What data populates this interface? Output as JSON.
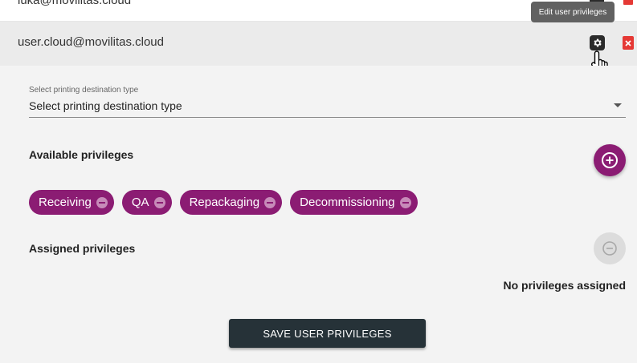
{
  "users": [
    {
      "email": "luka@movilitas.cloud"
    },
    {
      "email": "user.cloud@movilitas.cloud"
    }
  ],
  "tooltip": {
    "text": "Edit user privileges"
  },
  "printing": {
    "label": "Select printing destination type",
    "value": "Select printing destination type"
  },
  "available": {
    "heading": "Available privileges",
    "chips": [
      "Receiving",
      "QA",
      "Repackaging",
      "Decommissioning"
    ]
  },
  "assigned": {
    "heading": "Assigned privileges",
    "empty_text": "No privileges assigned"
  },
  "actions": {
    "save_label": "SAVE USER PRIVILEGES"
  },
  "colors": {
    "accent": "#8b1c73",
    "delete": "#e53935",
    "save_button": "#263238"
  },
  "icons": {
    "settings": "gear-icon",
    "delete": "trash-icon",
    "add": "plus-circle-icon",
    "remove": "minus-circle-icon",
    "chip_remove": "minus-icon",
    "cursor": "hand-pointer-icon"
  }
}
